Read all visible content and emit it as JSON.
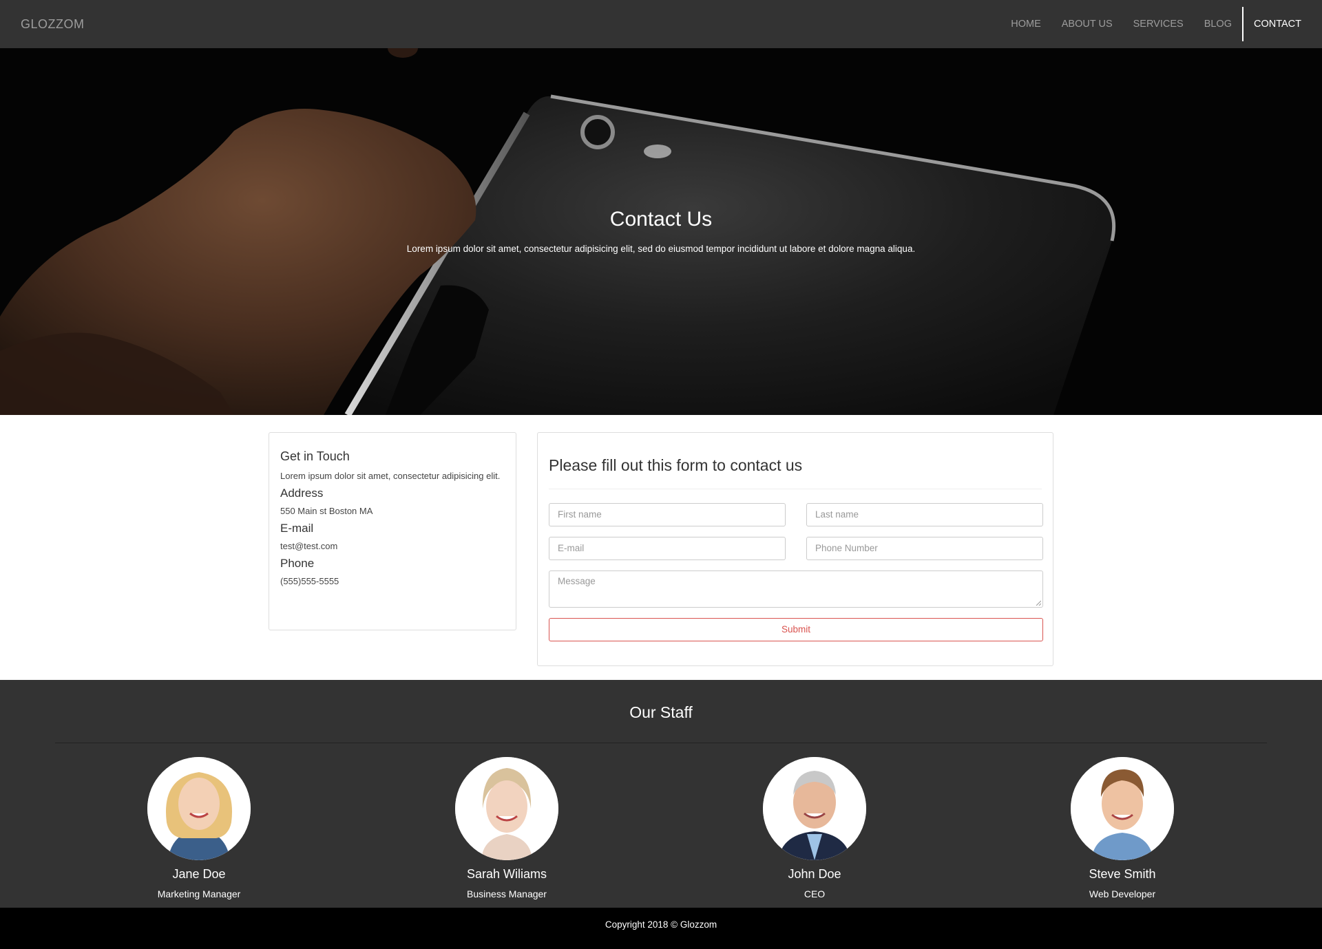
{
  "navbar": {
    "brand": "GLOZZOM",
    "items": [
      {
        "label": "HOME"
      },
      {
        "label": "ABOUT US"
      },
      {
        "label": "SERVICES"
      },
      {
        "label": "BLOG"
      },
      {
        "label": "CONTACT"
      }
    ],
    "active_item": "CONTACT"
  },
  "hero": {
    "title": "Contact Us",
    "subtitle": "Lorem ipsum dolor sit amet, consectetur adipisicing elit, sed do eiusmod tempor incididunt ut labore et dolore magna aliqua."
  },
  "contact_info": {
    "heading": "Get in Touch",
    "description": "Lorem ipsum dolor sit amet, consectetur adipisicing elit.",
    "address_label": "Address",
    "address_value": "550 Main st Boston MA",
    "email_label": "E-mail",
    "email_value": "test@test.com",
    "phone_label": "Phone",
    "phone_value": "(555)555-5555"
  },
  "contact_form": {
    "title": "Please fill out this form to contact us",
    "first_name_placeholder": "First name",
    "last_name_placeholder": "Last name",
    "email_placeholder": "E-mail",
    "phone_placeholder": "Phone Number",
    "message_placeholder": "Message",
    "submit_label": "Submit",
    "submit_color": "#d9534f"
  },
  "staff": {
    "title": "Our Staff",
    "members": [
      {
        "name": "Jane Doe",
        "role": "Marketing Manager"
      },
      {
        "name": "Sarah Wiliams",
        "role": "Business Manager"
      },
      {
        "name": "John Doe",
        "role": "CEO"
      },
      {
        "name": "Steve Smith",
        "role": "Web Developer"
      }
    ]
  },
  "footer": {
    "copyright": "Copyright 2018 © Glozzom"
  },
  "colors": {
    "navbar_bg": "#333333",
    "staff_bg": "#333333",
    "footer_bg": "#000000",
    "accent_red": "#d9534f"
  }
}
